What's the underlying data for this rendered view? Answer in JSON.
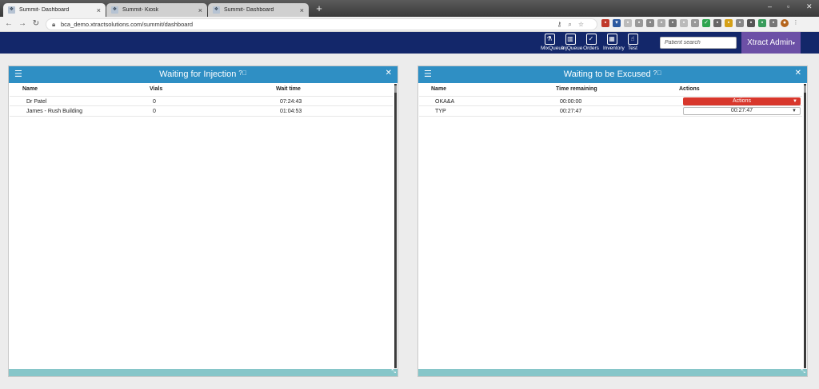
{
  "browser": {
    "tabs": [
      {
        "title": "Summit- Dashboard",
        "active": true
      },
      {
        "title": "Summit- Kiosk",
        "active": false
      },
      {
        "title": "Summit- Dashboard",
        "active": false
      }
    ],
    "new_tab": "+",
    "url": "bca_demo.xtractsolutions.com/summit/dashboard"
  },
  "header": {
    "nav": [
      {
        "label": "MixQueue",
        "icon": "flask-icon"
      },
      {
        "label": "InjQueue",
        "icon": "syringe-icon"
      },
      {
        "label": "Orders",
        "icon": "clipboard-icon"
      },
      {
        "label": "Inventory",
        "icon": "inventory-icon"
      },
      {
        "label": "Test",
        "icon": "hand-icon"
      }
    ],
    "search_placeholder": "Patient search",
    "admin_label": "Xtract Admin",
    "admin_caret": "▾"
  },
  "left_panel": {
    "title": "Waiting for Injection",
    "columns": [
      "Name",
      "Vials",
      "Wait time"
    ],
    "rows": [
      {
        "name": "Dr Patel",
        "vials": "0",
        "wait": "07:24:43"
      },
      {
        "name": "James - Rush Building",
        "vials": "0",
        "wait": "01:04:53"
      }
    ]
  },
  "right_panel": {
    "title": "Waiting to be Excused",
    "columns": [
      "Name",
      "Time remaining",
      "Actions"
    ],
    "rows": [
      {
        "name": "OKA&A",
        "time": "00:00:00",
        "action": "Actions",
        "action_style": "red"
      },
      {
        "name": "TYP",
        "time": "00:27:47",
        "action": "00:27:47",
        "action_style": "white"
      }
    ]
  },
  "colors": {
    "appbar": "#13276a",
    "panel_header": "#2f8fc4",
    "admin": "#6c50a6",
    "action_red": "#d8372c",
    "panel_footer": "#86c6c9"
  }
}
